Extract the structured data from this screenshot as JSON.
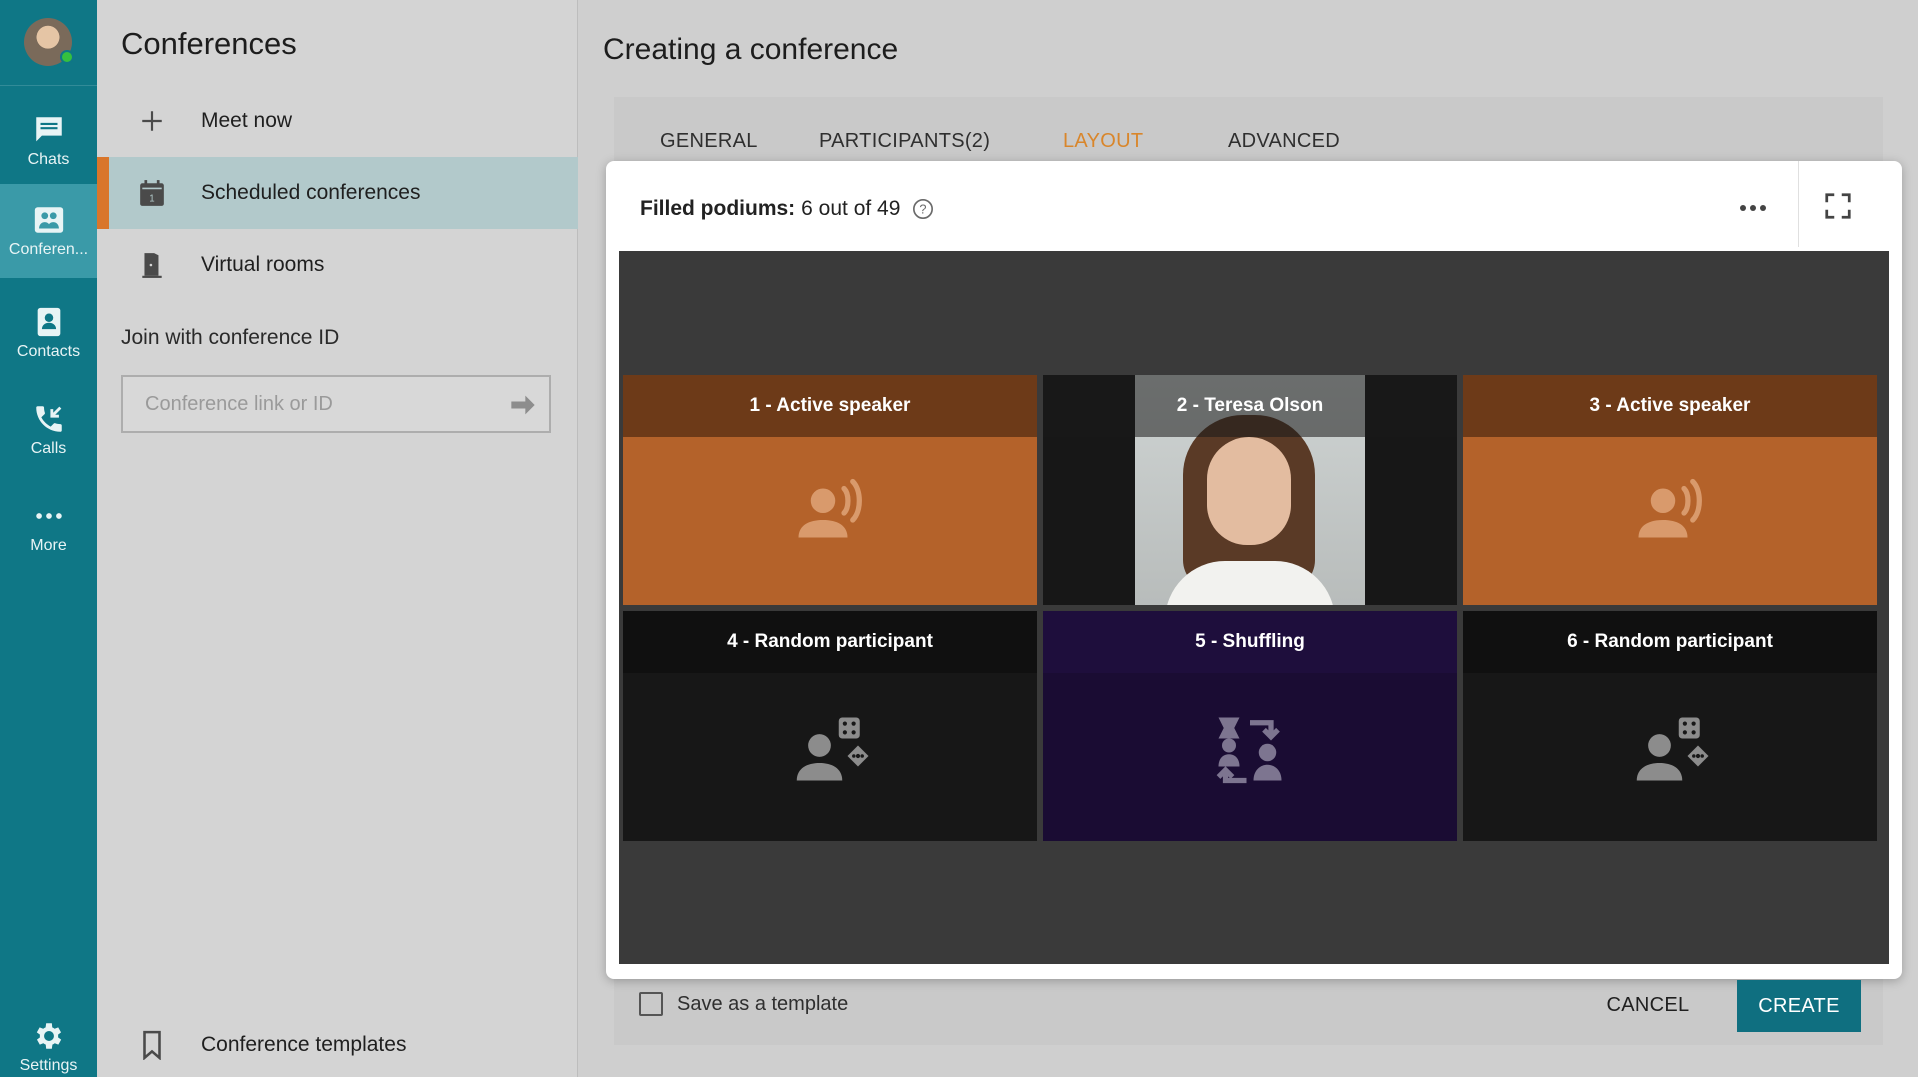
{
  "rail": {
    "items": [
      {
        "label": "Chats",
        "icon": "chat-icon"
      },
      {
        "label": "Conferen...",
        "icon": "conference-icon"
      },
      {
        "label": "Contacts",
        "icon": "contacts-icon"
      },
      {
        "label": "Calls",
        "icon": "calls-icon"
      },
      {
        "label": "More",
        "icon": "more-icon"
      },
      {
        "label": "Settings",
        "icon": "gear-icon"
      }
    ],
    "status_color": "#35c03f"
  },
  "sidebar": {
    "title": "Conferences",
    "items": [
      {
        "label": "Meet now",
        "icon": "plus-icon"
      },
      {
        "label": "Scheduled conferences",
        "icon": "calendar-icon"
      },
      {
        "label": "Virtual rooms",
        "icon": "door-icon"
      }
    ],
    "join_label": "Join with conference ID",
    "join_placeholder": "Conference link or ID",
    "templates_label": "Conference templates"
  },
  "main": {
    "title": "Creating a conference",
    "tabs": [
      {
        "label": "GENERAL",
        "active": false
      },
      {
        "label": "PARTICIPANTS(2)",
        "active": false
      },
      {
        "label": "LAYOUT",
        "active": true
      },
      {
        "label": "ADVANCED",
        "active": false
      }
    ],
    "filled_label": "Filled podiums:",
    "filled_value": "6 out of 49",
    "tiles": [
      {
        "label": "1 - Active speaker",
        "kind": "active-speaker"
      },
      {
        "label": "2 - Teresa Olson",
        "kind": "video"
      },
      {
        "label": "3 - Active speaker",
        "kind": "active-speaker"
      },
      {
        "label": "4 - Random participant",
        "kind": "random"
      },
      {
        "label": "5 - Shuffling",
        "kind": "shuffling"
      },
      {
        "label": "6 - Random participant",
        "kind": "random"
      }
    ],
    "save_template_label": "Save as a template",
    "cancel_label": "CANCEL",
    "create_label": "CREATE",
    "accent_color": "#d9862b",
    "primary_color": "#0f6f80"
  }
}
